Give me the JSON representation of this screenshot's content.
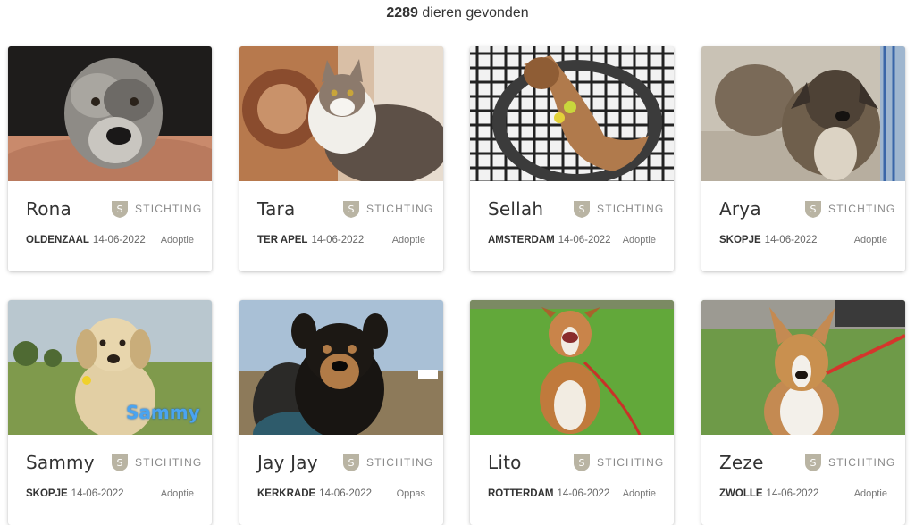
{
  "results": {
    "count": "2289",
    "label": "dieren gevonden"
  },
  "org_badge_color": "#b9b4a3",
  "cards": [
    {
      "name": "Rona",
      "org": "STICHTING",
      "city": "OLDENZAAL",
      "date": "14-06-2022",
      "type": "Adoptie",
      "photo": "dog-grey-scruffy"
    },
    {
      "name": "Tara",
      "org": "STICHTING",
      "city": "TER APEL",
      "date": "14-06-2022",
      "type": "Adoptie",
      "photo": "cat-tabby-white"
    },
    {
      "name": "Sellah",
      "org": "STICHTING",
      "city": "AMSTERDAM",
      "date": "14-06-2022",
      "type": "Adoptie",
      "photo": "dog-brown-on-bed"
    },
    {
      "name": "Arya",
      "org": "STICHTING",
      "city": "SKOPJE",
      "date": "14-06-2022",
      "type": "Adoptie",
      "photo": "dog-brindle"
    },
    {
      "name": "Sammy",
      "org": "STICHTING",
      "city": "SKOPJE",
      "date": "14-06-2022",
      "type": "Adoptie",
      "photo": "dog-yellow-field",
      "photo_text": "Sammy"
    },
    {
      "name": "Jay Jay",
      "org": "STICHTING",
      "city": "KERKRADE",
      "date": "14-06-2022",
      "type": "Oppas",
      "photo": "dog-black-tan"
    },
    {
      "name": "Lito",
      "org": "STICHTING",
      "city": "ROTTERDAM",
      "date": "14-06-2022",
      "type": "Adoptie",
      "photo": "dog-tan-grass"
    },
    {
      "name": "Zeze",
      "org": "STICHTING",
      "city": "ZWOLLE",
      "date": "14-06-2022",
      "type": "Adoptie",
      "photo": "dog-tan-white-leash"
    }
  ]
}
